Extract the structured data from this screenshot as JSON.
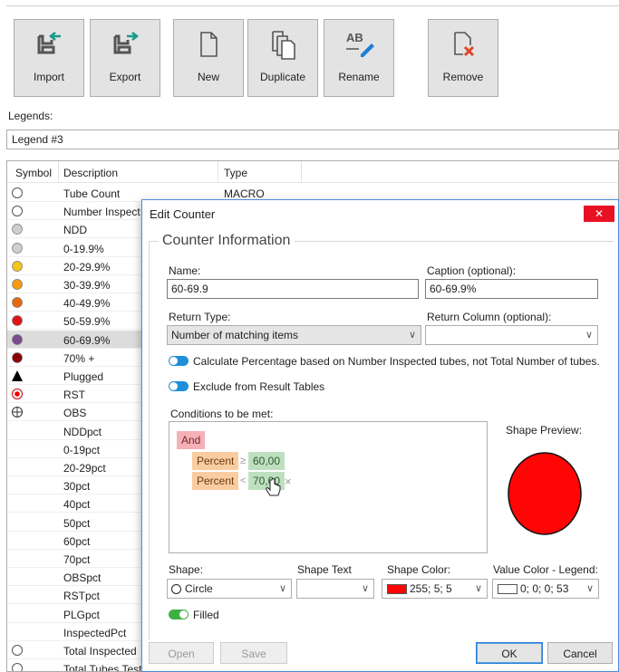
{
  "toolbar": {
    "buttons": [
      {
        "label": "Import",
        "icon": "import-icon"
      },
      {
        "label": "Export",
        "icon": "export-icon"
      },
      {
        "label": "New",
        "icon": "new-document-icon"
      },
      {
        "label": "Duplicate",
        "icon": "duplicate-icon"
      },
      {
        "label": "Rename",
        "icon": "rename-icon"
      },
      {
        "label": "Remove",
        "icon": "remove-icon"
      }
    ]
  },
  "legends": {
    "label": "Legends:",
    "selected": "Legend #3"
  },
  "table": {
    "headers": {
      "symbol": "Symbol",
      "description": "Description",
      "type": "Type"
    },
    "rows": [
      {
        "symbol": "circle-outline",
        "description": "Tube Count",
        "type": "MACRO"
      },
      {
        "symbol": "circle-outline",
        "description": "Number Inspect",
        "type": ""
      },
      {
        "symbol": "circle-gray",
        "description": "NDD",
        "type": ""
      },
      {
        "symbol": "circle-gray",
        "description": "0-19.9%",
        "type": ""
      },
      {
        "symbol": "circle-yellow",
        "description": "20-29.9%",
        "type": ""
      },
      {
        "symbol": "circle-orange",
        "description": "30-39.9%",
        "type": ""
      },
      {
        "symbol": "circle-darkorange",
        "description": "40-49.9%",
        "type": ""
      },
      {
        "symbol": "circle-red",
        "description": "50-59.9%",
        "type": ""
      },
      {
        "symbol": "circle-purple",
        "description": "60-69.9%",
        "type": ""
      },
      {
        "symbol": "circle-darkred",
        "description": "70% +",
        "type": ""
      },
      {
        "symbol": "triangle-black",
        "description": "Plugged",
        "type": ""
      },
      {
        "symbol": "circle-target",
        "description": "RST",
        "type": ""
      },
      {
        "symbol": "circle-cross",
        "description": "OBS",
        "type": ""
      },
      {
        "symbol": "none",
        "description": "NDDpct",
        "type": ""
      },
      {
        "symbol": "none",
        "description": "0-19pct",
        "type": ""
      },
      {
        "symbol": "none",
        "description": "20-29pct",
        "type": ""
      },
      {
        "symbol": "none",
        "description": "30pct",
        "type": ""
      },
      {
        "symbol": "none",
        "description": "40pct",
        "type": ""
      },
      {
        "symbol": "none",
        "description": "50pct",
        "type": ""
      },
      {
        "symbol": "none",
        "description": "60pct",
        "type": ""
      },
      {
        "symbol": "none",
        "description": "70pct",
        "type": ""
      },
      {
        "symbol": "none",
        "description": "OBSpct",
        "type": ""
      },
      {
        "symbol": "none",
        "description": "RSTpct",
        "type": ""
      },
      {
        "symbol": "none",
        "description": "PLGpct",
        "type": ""
      },
      {
        "symbol": "none",
        "description": "InspectedPct",
        "type": ""
      },
      {
        "symbol": "circle-outline",
        "description": "Total Inspected",
        "type": ""
      },
      {
        "symbol": "circle-outline",
        "description": "Total Tubes Test",
        "type": ""
      }
    ],
    "selected_index": 8
  },
  "dialog": {
    "title": "Edit Counter",
    "close_label": "✕",
    "group_title": "Counter Information",
    "name": {
      "label": "Name:",
      "value": "60-69.9"
    },
    "caption": {
      "label": "Caption (optional):",
      "value": "60-69.9%"
    },
    "return_type": {
      "label": "Return Type:",
      "value": "Number of matching items"
    },
    "return_column": {
      "label": "Return Column (optional):",
      "value": ""
    },
    "calc_pct_label": "Calculate Percentage based on Number Inspected tubes, not Total Number of tubes.",
    "exclude_label": "Exclude from Result Tables",
    "conditions": {
      "label": "Conditions to be met:",
      "operator": "And",
      "rows": [
        {
          "field": "Percent",
          "op": "≥",
          "value": "60,00"
        },
        {
          "field": "Percent",
          "op": "<",
          "value": "70,00"
        }
      ],
      "remove_glyph": "×"
    },
    "shape_preview_label": "Shape Preview:",
    "shape_color_hex": "#ff0505",
    "shape": {
      "label": "Shape:",
      "value": "Circle",
      "icon": "circle-shape-icon"
    },
    "shape_text": {
      "label": "Shape Text",
      "value": ""
    },
    "shape_color": {
      "label": "Shape Color:",
      "value": "255; 5; 5",
      "swatch": "#ff0505"
    },
    "value_color": {
      "label": "Value Color - Legend:",
      "value": "0; 0; 0; 53",
      "swatch": "#ffffff"
    },
    "filled_label": "Filled",
    "buttons": {
      "open": "Open",
      "save": "Save",
      "ok": "OK",
      "cancel": "Cancel"
    }
  }
}
